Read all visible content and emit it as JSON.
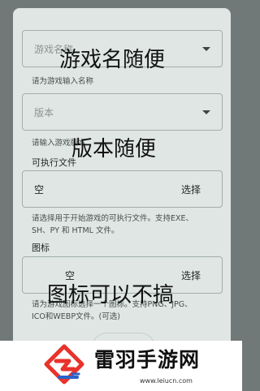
{
  "game_name": {
    "placeholder": "游戏名称",
    "helper": "请为游戏输入名称"
  },
  "version": {
    "placeholder": "版本",
    "helper": "请输入游戏版本"
  },
  "executable": {
    "section_label": "可执行文件",
    "value": "空",
    "button_label": "选择",
    "helper_line1": "请选择用于开始游戏的可执行文件。支持EXE、",
    "helper_line2": "SH、PY 和 HTML 文件。"
  },
  "icon": {
    "section_label": "图标",
    "value": "空",
    "button_label": "选择",
    "helper_line1": "请为游戏图标选择一个图标。支持PNG、JPG、",
    "helper_line2": "ICO和WEBP文件。(可选)"
  },
  "overlays": {
    "text1": "游戏名随便",
    "text2": "版本随便",
    "text3": "图标可以不搞"
  },
  "watermark": {
    "title": "雷羽手游网",
    "url": "www.leiucn.com"
  },
  "colors": {
    "brand_red": "#e8322b",
    "brand_blue": "#2a62c9"
  }
}
